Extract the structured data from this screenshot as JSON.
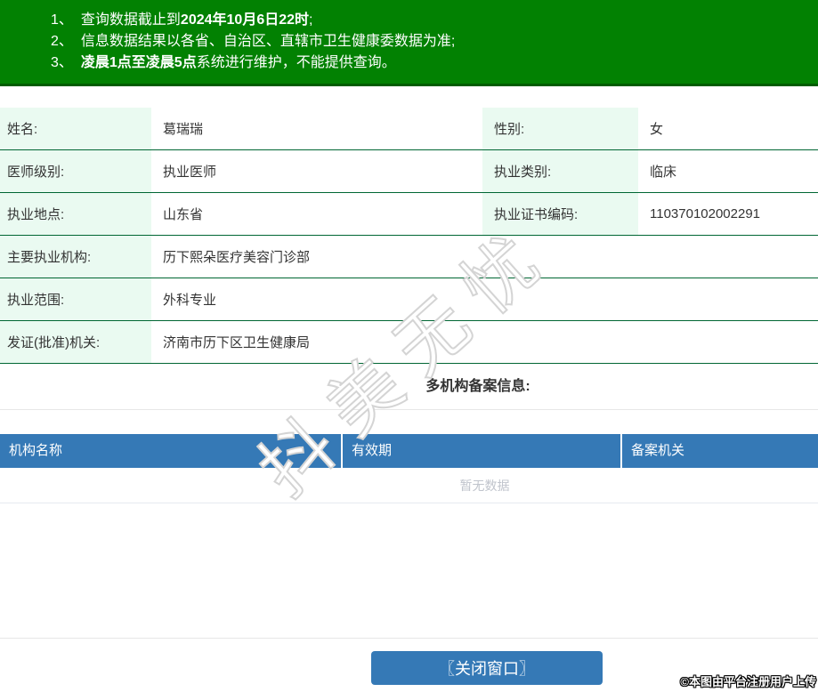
{
  "banner": {
    "items": [
      {
        "num": "1、",
        "pre": "查询数据截止到",
        "bold": "2024年10月6日22时",
        "post": ";"
      },
      {
        "num": "2、",
        "pre": "信息数据结果以各省、自治区、直辖市卫生健康委数据为准;",
        "bold": "",
        "post": ""
      },
      {
        "num": "3、",
        "pre": "",
        "bold": "凌晨1点至凌晨5点",
        "post": "系统进行维护，不能提供查询。"
      }
    ]
  },
  "doctor": {
    "rows": [
      {
        "label1": "姓名:",
        "value1": "葛瑞瑞",
        "label2": "性别:",
        "value2": "女"
      },
      {
        "label1": "医师级别:",
        "value1": "执业医师",
        "label2": "执业类别:",
        "value2": "临床"
      },
      {
        "label1": "执业地点:",
        "value1": "山东省",
        "label2": "执业证书编码:",
        "value2": "110370102002291"
      },
      {
        "label1": "主要执业机构:",
        "value1": "历下熙朵医疗美容门诊部"
      },
      {
        "label1": "执业范围:",
        "value1": "外科专业"
      },
      {
        "label1": "发证(批准)机关:",
        "value1": "济南市历下区卫生健康局"
      }
    ]
  },
  "multi_org": {
    "heading": "多机构备案信息:",
    "columns": [
      "机构名称",
      "有效期",
      "备案机关"
    ],
    "empty_text": "暂无数据"
  },
  "watermark": "抖美无忧",
  "footer": {
    "close_button": "〖关闭窗口〗",
    "attribution": "©本图由平台注册用户上传"
  },
  "colors": {
    "banner_green": "#028102",
    "table_border_green": "#006633",
    "label_bg_mint": "#eafaf1",
    "header_blue": "#3579b6",
    "button_blue": "#3579b6",
    "empty_text_gray": "#c0c4cc"
  }
}
